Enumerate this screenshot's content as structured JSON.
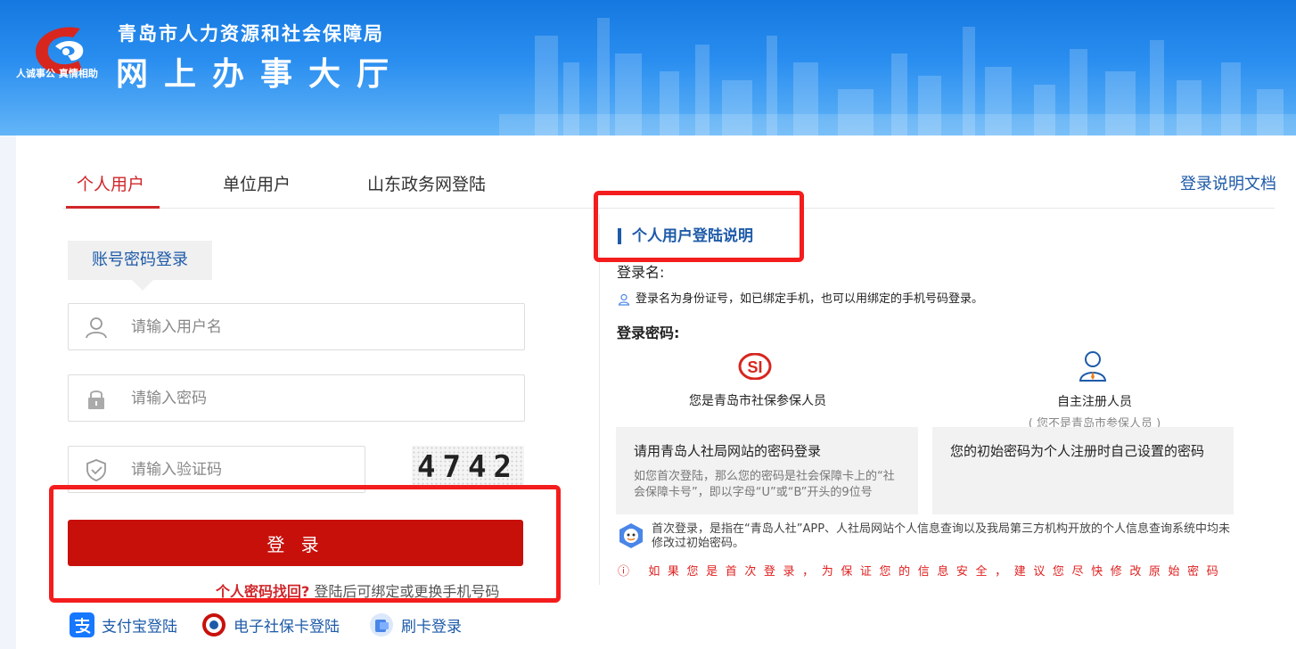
{
  "header": {
    "org_name": "青岛市人力资源和社会保障局",
    "hall_name": "网上办事大厅",
    "slogan": "人诚事公 真情相助"
  },
  "tabs": [
    {
      "label": "个人用户",
      "active": true
    },
    {
      "label": "单位用户",
      "active": false
    },
    {
      "label": "山东政务网登陆",
      "active": false
    }
  ],
  "doc_link": "登录说明文档",
  "login": {
    "type_label": "账号密码登录",
    "username_placeholder": "请输入用户名",
    "password_placeholder": "请输入密码",
    "captcha_placeholder": "请输入验证码",
    "captcha_code": "4742",
    "submit_label": "登 录",
    "forgot_label": "个人密码找回?",
    "forgot_hint": "登陆后可绑定或更换手机号码"
  },
  "alt_logins": [
    {
      "label": "支付宝登陆",
      "icon": "alipay-icon"
    },
    {
      "label": "电子社保卡登陆",
      "icon": "social-security-card-icon"
    },
    {
      "label": "刷卡登录",
      "icon": "card-swipe-icon"
    }
  ],
  "info": {
    "title": "个人用户登陆说明",
    "login_name_label": "登录名:",
    "login_name_note": "登录名为身份证号，如已绑定手机，也可以用绑定的手机号码登录。",
    "password_label": "登录密码:",
    "role_insured": "您是青岛市社保参保人员",
    "role_self": "自主注册人员",
    "role_self_sub": "( 您不是青岛市参保人员 )",
    "box_insured_title": "请用青岛人社局网站的密码登录",
    "box_insured_text": "如您首次登陆，那么您的密码是社会保障卡上的“社会保障卡号”，即以字母“U”或“B”开头的9位号",
    "box_self_title": "您的初始密码为个人注册时自己设置的密码",
    "first_login_note": "首次登录，是指在“青岛人社”APP、人社局网站个人信息查询以及我局第三方机构开放的个人信息查询系统中均未修改过初始密码。",
    "warning": "ⓘ 如果您是首次登录，为保证您的信息安全，建议您尽快修改原始密码"
  },
  "colors": {
    "brand_red": "#c8100b",
    "link_blue": "#1d5aa8",
    "header_blue": "#1478e0",
    "annotation_red": "#f41d1d"
  }
}
